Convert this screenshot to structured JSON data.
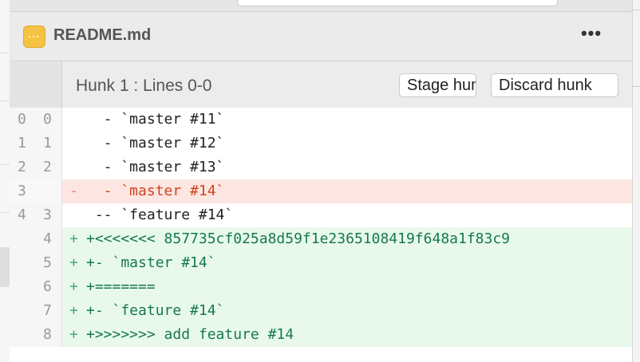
{
  "file": {
    "name": "README.md",
    "icon": "file-modified-icon",
    "icon_glyph": "···",
    "icon_color": "#f5c344",
    "more_label": "•••"
  },
  "hunk": {
    "title": "Hunk 1 : Lines 0-0",
    "stage_label": "Stage hunk",
    "discard_label": "Discard hunk"
  },
  "lines": [
    {
      "type": "context",
      "old": "0",
      "new": "0",
      "sign": "",
      "text": "  - `master #11`"
    },
    {
      "type": "context",
      "old": "1",
      "new": "1",
      "sign": "",
      "text": "  - `master #12`"
    },
    {
      "type": "context",
      "old": "2",
      "new": "2",
      "sign": "",
      "text": "  - `master #13`"
    },
    {
      "type": "removed",
      "old": "3",
      "new": "",
      "sign": "-",
      "text": "  - `master #14`"
    },
    {
      "type": "context",
      "old": "4",
      "new": "3",
      "sign": "",
      "text": " -- `feature #14`"
    },
    {
      "type": "added",
      "old": "",
      "new": "4",
      "sign": "+",
      "text": "+<<<<<<< 857735cf025a8d59f1e2365108419f648a1f83c9"
    },
    {
      "type": "added",
      "old": "",
      "new": "5",
      "sign": "+",
      "text": "+- `master #14`"
    },
    {
      "type": "added",
      "old": "",
      "new": "6",
      "sign": "+",
      "text": "+======="
    },
    {
      "type": "added",
      "old": "",
      "new": "7",
      "sign": "+",
      "text": "+- `feature #14`"
    },
    {
      "type": "added",
      "old": "",
      "new": "8",
      "sign": "+",
      "text": "+>>>>>>> add feature #14"
    }
  ],
  "colors": {
    "removed_bg": "#fde6e1",
    "added_bg": "#e8f9ec",
    "removed_text": "#d0421f",
    "added_text": "#17784a"
  }
}
